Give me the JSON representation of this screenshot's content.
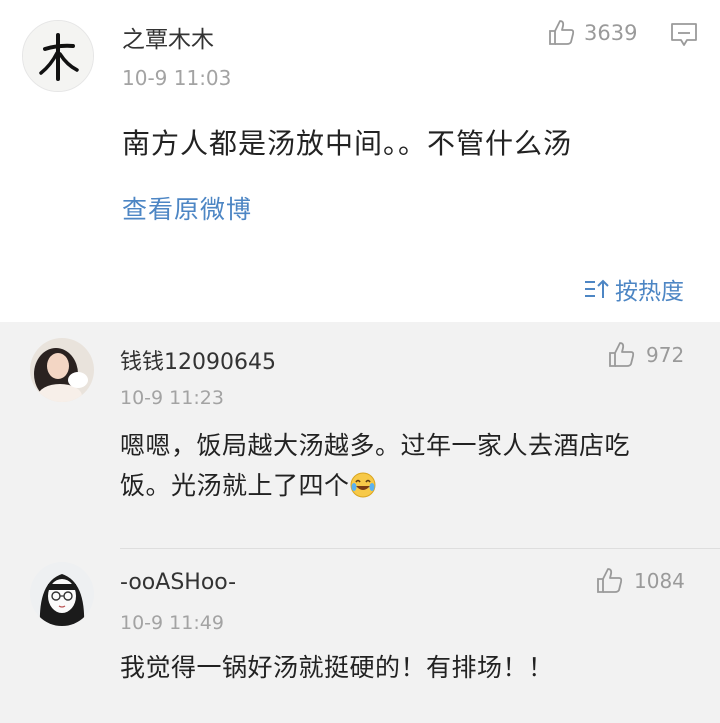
{
  "main_post": {
    "avatar_glyph": "木",
    "username": "之覃木木",
    "timestamp": "10-9 11:03",
    "content": "南方人都是汤放中间。。不管什么汤",
    "view_original": "查看原微博",
    "likes": "3639",
    "like_icon": "thumbs-up-icon",
    "comment_icon": "comment-icon"
  },
  "sort": {
    "icon": "sort-icon",
    "label": "按热度"
  },
  "comments": [
    {
      "username": "钱钱12090645",
      "timestamp": "10-9 11:23",
      "content_line1": "嗯嗯，饭局越大汤越多。过年一家人去酒店吃",
      "content_line2": "饭。光汤就上了四个",
      "emoji": "crying-laughing-emoji",
      "likes": "972"
    },
    {
      "username": "-ooASHoo-",
      "timestamp": "10-9 11:49",
      "content": "我觉得一锅好汤就挺硬的！有排场！！",
      "likes": "1084"
    }
  ],
  "colors": {
    "link": "#4d86c4",
    "comments_bg": "#f2f2f2",
    "muted": "#a3a3a3"
  }
}
